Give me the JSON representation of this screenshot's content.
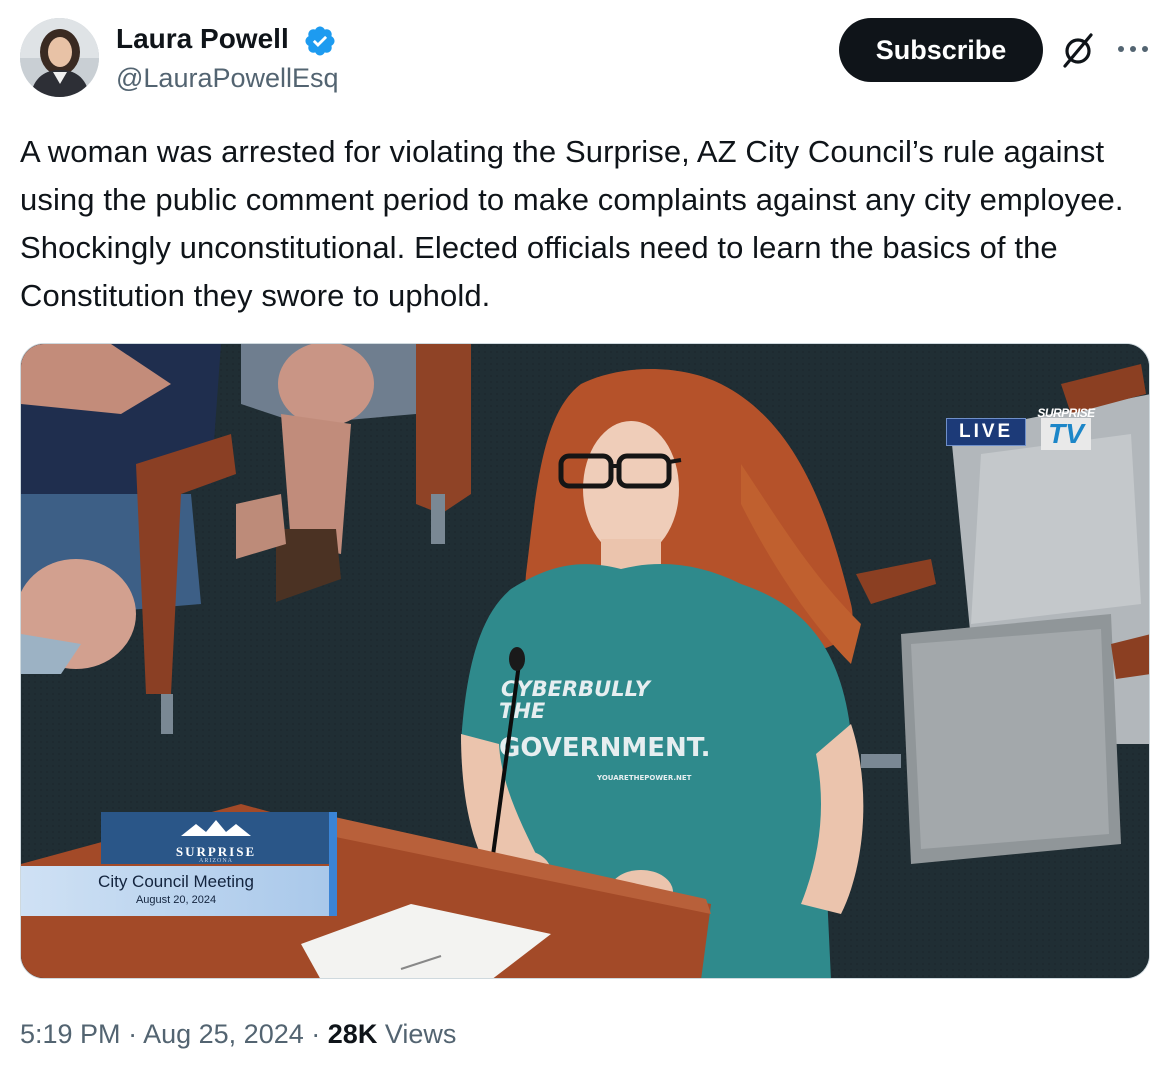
{
  "author": {
    "name": "Laura Powell",
    "handle": "@LauraPowellEsq",
    "verified": true
  },
  "actions": {
    "subscribe_label": "Subscribe",
    "grok_icon": "slashed-circle-icon",
    "more_icon": "more-horizontal-icon"
  },
  "tweet": {
    "text": "A woman was arrested for violating the Surprise, AZ City Council’s rule against using the public comment period to make complaints against any city employee. Shockingly unconstitutional. Elected officials need to learn the basics of the Constitution they swore to uphold."
  },
  "media": {
    "live_label": "LIVE",
    "tv_logo_top": "SURPRISE",
    "tv_logo_main": "TV",
    "shirt_lines": [
      "CYBERBULLY",
      "THE",
      "GOVERNMENT.",
      "YOUARETHEPOWER.NET"
    ],
    "lower_third": {
      "brand": "SURPRISE",
      "brand_sub": "ARIZONA",
      "title": "City Council Meeting",
      "date": "August 20, 2024"
    }
  },
  "footer": {
    "time": "5:19 PM",
    "separator": "·",
    "date": "Aug 25, 2024",
    "views_count": "28K",
    "views_label": "Views"
  },
  "colors": {
    "text_primary": "#0f1419",
    "text_secondary": "#536471",
    "verified_blue": "#1d9bf0",
    "button_dark": "#0f1419"
  }
}
